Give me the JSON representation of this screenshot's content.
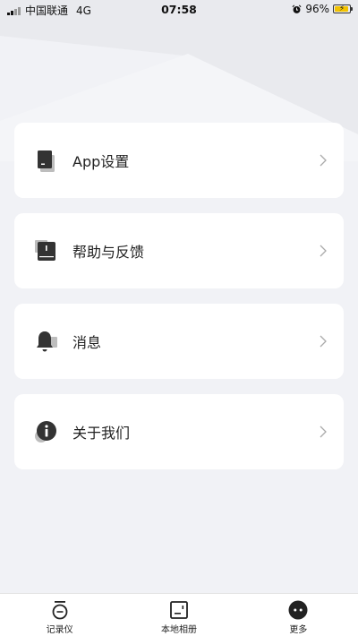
{
  "status_bar": {
    "carrier": "中国联通",
    "network": "4G",
    "time": "07:58",
    "battery_percent": "96%",
    "battery_level": 0.96,
    "alarm_icon": "alarm-clock-icon",
    "battery_color": "#f2c200"
  },
  "menu": {
    "items": [
      {
        "label": "App设置",
        "icon": "phone-settings-icon"
      },
      {
        "label": "帮助与反馈",
        "icon": "book-icon"
      },
      {
        "label": "消息",
        "icon": "bell-icon"
      },
      {
        "label": "关于我们",
        "icon": "info-icon"
      }
    ]
  },
  "tab_bar": {
    "items": [
      {
        "label": "记录仪",
        "icon": "recorder-icon"
      },
      {
        "label": "本地相册",
        "icon": "album-icon"
      },
      {
        "label": "更多",
        "icon": "more-icon",
        "active": true
      }
    ]
  },
  "colors": {
    "background": "#f1f2f6",
    "card": "#ffffff",
    "icon_dark": "#333333",
    "icon_shadow": "#b8b8b8"
  }
}
